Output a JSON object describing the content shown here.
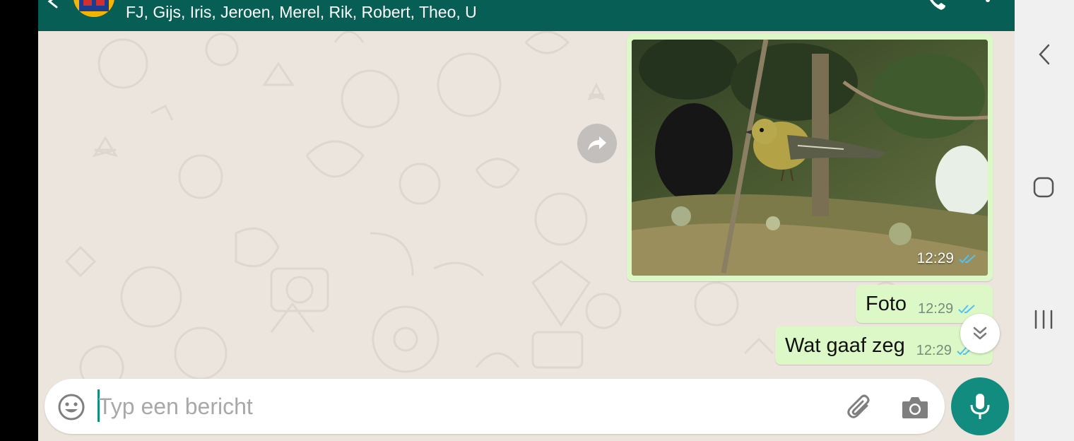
{
  "header": {
    "members": "FJ, Gijs, Iris, Jeroen, Merel, Rik, Robert, Theo, U",
    "back_icon": "arrow-left-icon",
    "call_icon": "phone-icon",
    "menu_icon": "more-vert-icon"
  },
  "messages": [
    {
      "type": "image",
      "time": "12:29",
      "status": "read"
    },
    {
      "type": "text",
      "text": "Foto",
      "time": "12:29",
      "status": "read"
    },
    {
      "type": "text",
      "text": "Wat gaaf zeg",
      "time": "12:29",
      "status": "read"
    }
  ],
  "composer": {
    "placeholder": "Typ een bericht",
    "value": ""
  },
  "icons": {
    "emoji": "emoji-icon",
    "attach": "paperclip-icon",
    "camera": "camera-icon",
    "mic": "mic-icon",
    "forward": "forward-icon",
    "scroll_down": "double-chevron-down-icon"
  },
  "colors": {
    "header": "#075e54",
    "outgoing_bubble": "#dcf8c6",
    "accent": "#128c7e",
    "read_ticks": "#4fc3f7",
    "chat_background": "#ece5dd"
  }
}
